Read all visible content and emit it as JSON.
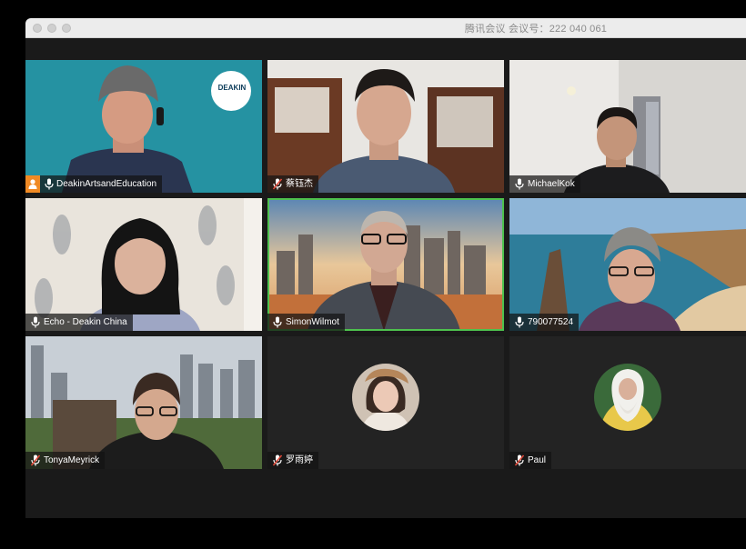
{
  "window": {
    "title": "腾讯会议 会议号：222 040 061"
  },
  "participants": [
    {
      "name": "DeakinArtsandEducation",
      "host": true,
      "muted": false,
      "logo_text": "DEAKIN"
    },
    {
      "name": "蔡钰杰",
      "muted": true
    },
    {
      "name": "MichaelKok",
      "muted": false
    },
    {
      "name": "Echo - Deakin China",
      "muted": false
    },
    {
      "name": "SimonWilmot",
      "muted": false,
      "speaking": true
    },
    {
      "name": "790077524",
      "muted": false
    },
    {
      "name": "TonyaMeyrick",
      "muted": true
    },
    {
      "name": "罗雨婷",
      "muted": true
    },
    {
      "name": "Paul",
      "muted": true
    }
  ],
  "colors": {
    "active_speaker": "#4ec24e",
    "host_badge": "#f08a24",
    "muted_mic": "#e04a3a"
  }
}
